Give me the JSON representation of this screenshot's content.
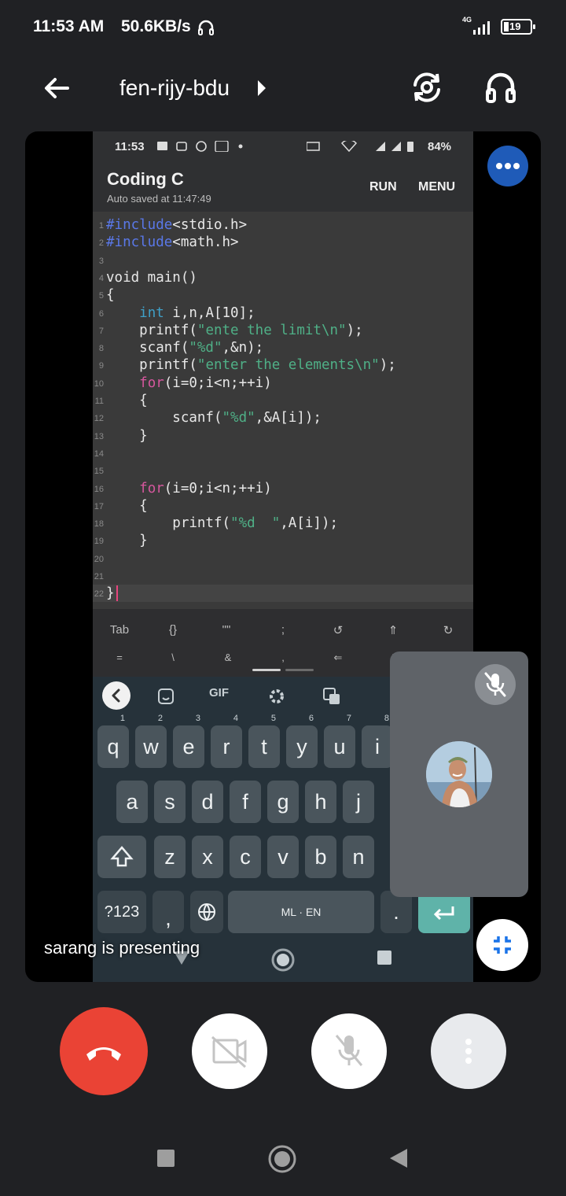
{
  "status_bar": {
    "time": "11:53 AM",
    "net_speed": "50.6KB/s",
    "network_type": "4G",
    "battery": "19"
  },
  "app_bar": {
    "meeting_code": "fen-rijy-bdu",
    "icons": [
      "back-arrow-icon",
      "caret-right-icon",
      "switch-camera-icon",
      "headphones-icon"
    ]
  },
  "shared_screen": {
    "status_time": "11:53",
    "status_battery": "84%",
    "app_title": "Coding C",
    "autosave": "Auto saved at 11:47:49",
    "run_label": "RUN",
    "menu_label": "MENU",
    "code_lines": [
      {
        "n": "1",
        "text": "#include<stdio.h>"
      },
      {
        "n": "2",
        "text": "#include<math.h>"
      },
      {
        "n": "3",
        "text": ""
      },
      {
        "n": "4",
        "text": "void main()"
      },
      {
        "n": "5",
        "text": "{"
      },
      {
        "n": "6",
        "text": "    int i,n,A[10];"
      },
      {
        "n": "7",
        "text": "    printf(\"ente the limit\\n\");"
      },
      {
        "n": "8",
        "text": "    scanf(\"%d\",&n);"
      },
      {
        "n": "9",
        "text": "    printf(\"enter the elements\\n\");"
      },
      {
        "n": "10",
        "text": "    for(i=0;i<n;++i)"
      },
      {
        "n": "11",
        "text": "    {"
      },
      {
        "n": "12",
        "text": "        scanf(\"%d\",&A[i]);"
      },
      {
        "n": "13",
        "text": "    }"
      },
      {
        "n": "14",
        "text": ""
      },
      {
        "n": "15",
        "text": ""
      },
      {
        "n": "16",
        "text": "    for(i=0;i<n;++i)"
      },
      {
        "n": "17",
        "text": "    {"
      },
      {
        "n": "18",
        "text": "        printf(\"%d  \",A[i]);"
      },
      {
        "n": "19",
        "text": "    }"
      },
      {
        "n": "20",
        "text": ""
      },
      {
        "n": "21",
        "text": ""
      },
      {
        "n": "22",
        "text": "}"
      }
    ],
    "extra_keys_row1": [
      "Tab",
      "{}",
      "\"\"",
      ";",
      "↺",
      "⇑",
      "↻"
    ],
    "extra_keys_row2": [
      "=",
      "\\",
      "&",
      ",",
      "⇐",
      "!"
    ],
    "keyboard": {
      "toolbar": [
        "GIF"
      ],
      "row1": [
        {
          "k": "q",
          "h": "1"
        },
        {
          "k": "w",
          "h": "2"
        },
        {
          "k": "e",
          "h": "3"
        },
        {
          "k": "r",
          "h": "4"
        },
        {
          "k": "t",
          "h": "5"
        },
        {
          "k": "y",
          "h": "6"
        },
        {
          "k": "u",
          "h": "7"
        },
        {
          "k": "i",
          "h": "8"
        }
      ],
      "row2": [
        "a",
        "s",
        "d",
        "f",
        "g",
        "h",
        "j"
      ],
      "row3": [
        "z",
        "x",
        "c",
        "v",
        "b",
        "n"
      ],
      "sym_key": "?123",
      "comma": ",",
      "space_label": "ML · EN",
      "period": "."
    }
  },
  "presenter_label": "sarang is presenting",
  "controls": [
    "end-call-icon",
    "camera-off-icon",
    "mic-off-icon",
    "more-vert-icon"
  ],
  "colors": {
    "end_call": "#ea4335",
    "accent_blue": "#1f5bb8",
    "background": "#202124"
  }
}
